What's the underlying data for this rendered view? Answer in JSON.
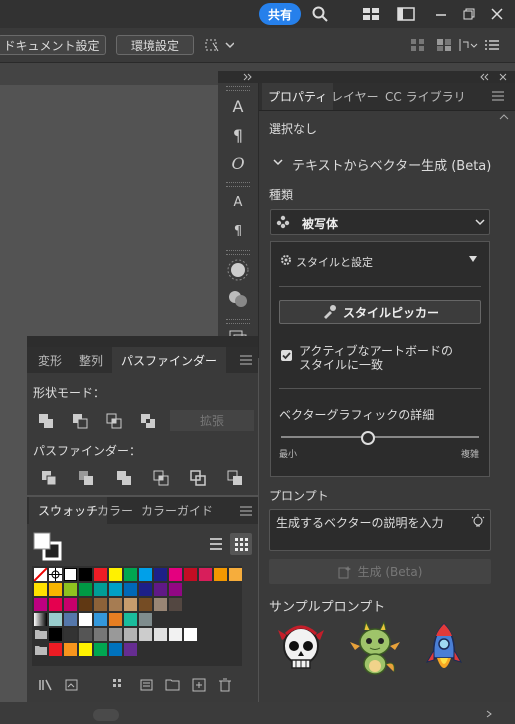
{
  "titlebar": {
    "share_label": "共有",
    "icons": [
      "search-icon",
      "workspace-icon",
      "panel-icon",
      "minimize-icon",
      "restore-icon",
      "close-icon"
    ]
  },
  "control_bar": {
    "doc_settings": "ドキュメント設定",
    "env_settings": "環境設定"
  },
  "properties": {
    "tabs": [
      "プロパティ",
      "レイヤー",
      "CC ライブラリ"
    ],
    "selection": "選択なし",
    "section_title": "テキストからベクター生成 (Beta)",
    "type_label": "種類",
    "type_value": "被写体",
    "style_section": "スタイルと設定",
    "style_picker": "スタイルピッカー",
    "checkbox_label_1": "アクティブなアートボードの",
    "checkbox_label_2": "スタイルに一致",
    "checkbox_checked": true,
    "detail_label": "ベクターグラフィックの詳細",
    "slider_min": "最小",
    "slider_max": "複雑",
    "slider_value": 0.44,
    "prompt_label": "プロンプト",
    "prompt_placeholder": "生成するベクターの説明を入力",
    "generate_label": "生成 (Beta)",
    "samples_label": "サンプルプロンプト"
  },
  "transform_panel": {
    "tabs": [
      "変形",
      "整列",
      "パスファインダー"
    ],
    "shape_modes": "形状モード：",
    "expand": "拡張",
    "pathfinders": "パスファインダー："
  },
  "swatches_panel": {
    "tabs": [
      "スウォッチ",
      "カラー",
      "カラーガイド"
    ],
    "row1": [
      "#000000",
      "#ee1c25",
      "#fff100",
      "#00a651",
      "#00a0e9",
      "#1d2088",
      "#e4007f",
      "#c30d23",
      "#d81e5b",
      "#f39800",
      "#f6ad3c"
    ],
    "row2": [
      "#ffe100",
      "#f8b500",
      "#8fc31f",
      "#009944",
      "#009e96",
      "#00a0c6",
      "#0068b7",
      "#1d2088",
      "#601986",
      "#920783"
    ],
    "row3": [
      "#be0081",
      "#e5004f",
      "#c7006b",
      "#603813",
      "#8c6239",
      "#a67c52",
      "#c69c6d",
      "#754c24",
      "#998675",
      "#534741"
    ],
    "row4": [
      "#ffffff",
      "#3498db",
      "#e67e22",
      "#1abc9c",
      "#7f8c8d"
    ],
    "row5": [
      "#000000",
      "#333333",
      "#555555",
      "#777777",
      "#999999",
      "#b3b3b3",
      "#cccccc",
      "#e0e0e0",
      "#f2f2f2",
      "#ffffff"
    ],
    "row6": [
      "#ed1c24",
      "#f7941d",
      "#fff200",
      "#00a651",
      "#0072bc",
      "#662d91"
    ]
  }
}
